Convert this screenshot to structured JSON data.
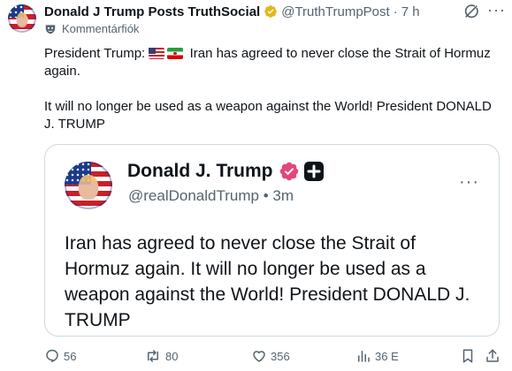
{
  "post": {
    "author_name": "Donald J Trump Posts TruthSocial",
    "handle": "@TruthTrumpPost",
    "separator": "·",
    "time": "7 h",
    "label": "Kommentárfiók",
    "text_prefix": "President Trump:",
    "flags": [
      "us-flag-icon",
      "iran-flag-icon"
    ],
    "text_line1_rest": "Iran has agreed to never close the Strait of Hormuz again.",
    "text_para2": "It will no longer be used as a weapon against the World! President DONALD J. TRUMP"
  },
  "quoted": {
    "author_name": "Donald J. Trump",
    "handle": "@realDonaldTrump",
    "separator": "•",
    "time": "3m",
    "text": "Iran has agreed to never close the Strait of Hormuz again. It will no longer be used as a weapon against the World! President DONALD J. TRUMP"
  },
  "actions": {
    "replies": "56",
    "reposts": "80",
    "likes": "356",
    "views": "36 E"
  },
  "colors": {
    "text": "#0f1419",
    "secondary": "#536471",
    "verified_gold": "#e2b719",
    "verified_pink": "#e2477b",
    "border": "#cfd9de"
  }
}
